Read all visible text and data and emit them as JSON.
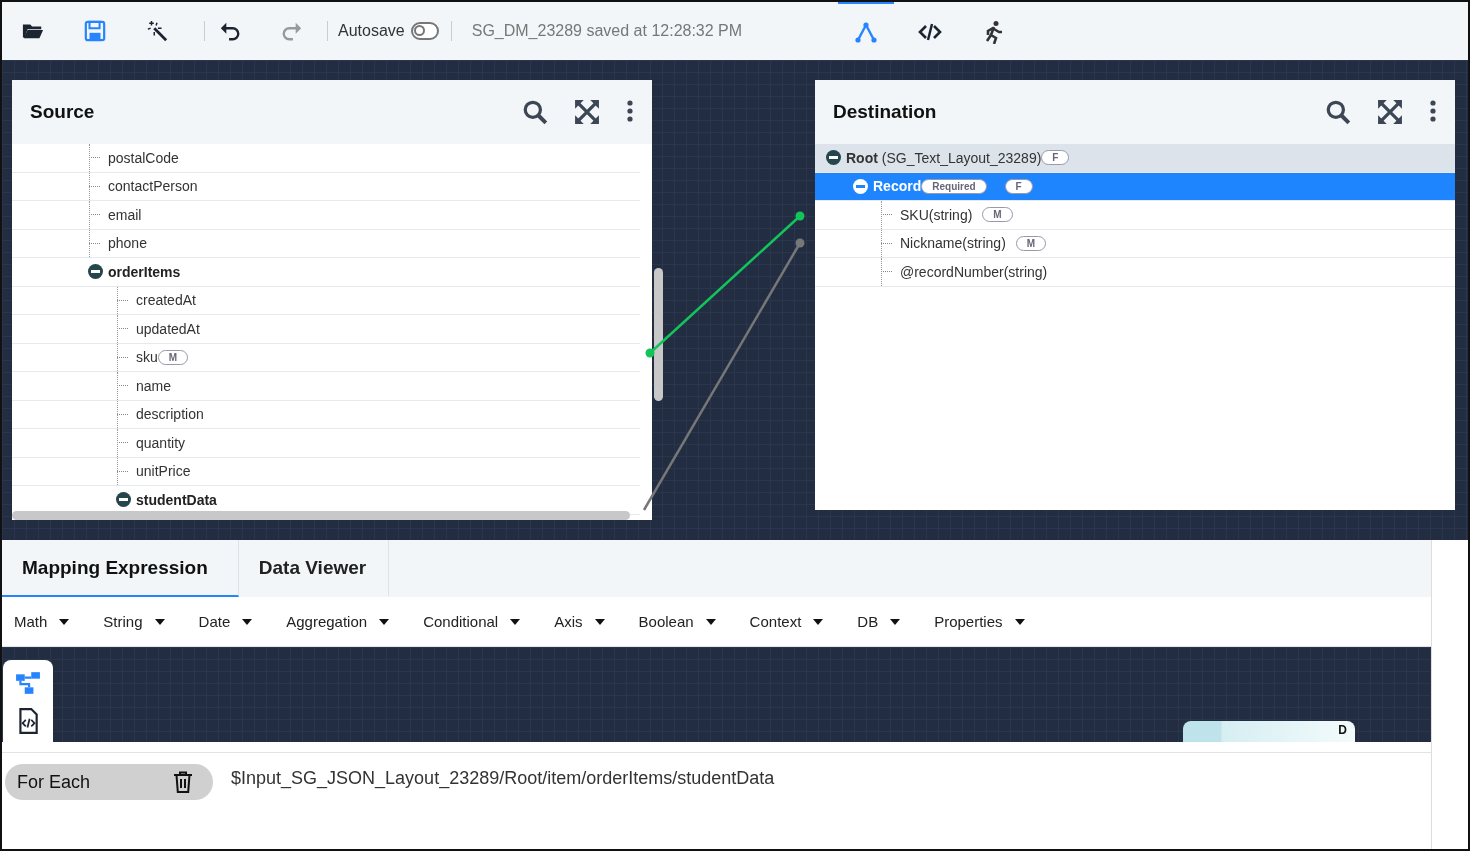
{
  "toolbar": {
    "buttons": [
      {
        "kind": "folder",
        "disabled": false
      },
      {
        "kind": "save",
        "disabled": false
      },
      {
        "kind": "wand",
        "disabled": false
      },
      {
        "kind": "undo",
        "disabled": false
      },
      {
        "kind": "redo",
        "disabled": true
      }
    ],
    "autosave": {
      "label": "Autosave",
      "on": false
    },
    "status": "SG_DM_23289 saved at 12:28:32 PM",
    "views": [
      {
        "kind": "mapping",
        "selected": true
      },
      {
        "kind": "code",
        "selected": false
      },
      {
        "kind": "run",
        "selected": false
      }
    ]
  },
  "source": {
    "title": "Source",
    "items": [
      {
        "label": "postalCode"
      },
      {
        "label": "contactPerson"
      },
      {
        "label": "email"
      },
      {
        "label": "phone"
      },
      {
        "label": "orderItems",
        "expanded": true,
        "children": [
          {
            "label": "createdAt"
          },
          {
            "label": "updatedAt"
          },
          {
            "label": "sku",
            "badges": [
              "M"
            ]
          },
          {
            "label": "name"
          },
          {
            "label": "description"
          },
          {
            "label": "quantity"
          },
          {
            "label": "unitPrice"
          },
          {
            "label": "studentData",
            "expanded": true
          }
        ]
      }
    ]
  },
  "destination": {
    "title": "Destination",
    "items": [
      {
        "label": "**Root** (SG_Text_Layout_23289)",
        "badges": [
          "F"
        ],
        "expanded": true,
        "selected": false,
        "children": [
          {
            "label": "Record",
            "badges": [
              "Required",
              "F"
            ],
            "expanded": true,
            "selected": true,
            "children": [
              {
                "label": "SKU(string)",
                "badges": [
                  "M"
                ],
                "selected": false
              },
              {
                "label": "Nickname(string)",
                "badges": [
                  "M"
                ],
                "selected": false
              },
              {
                "label": "@recordNumber(string)",
                "selected": false
              }
            ]
          }
        ]
      }
    ]
  },
  "links": [
    {
      "active": true
    },
    {
      "active": false
    }
  ],
  "bottom_tabs": [
    {
      "label": "Mapping Expression",
      "selected": true
    },
    {
      "label": "Data Viewer",
      "selected": false
    }
  ],
  "menus": [
    "Math",
    "String",
    "Date",
    "Aggregation",
    "Conditional",
    "Axis",
    "Boolean",
    "Context",
    "DB",
    "Properties"
  ],
  "side_tools": [
    {
      "kind": "tree",
      "selected": true
    },
    {
      "kind": "code",
      "selected": false
    }
  ],
  "node": {
    "label": "D"
  },
  "expression": {
    "chip": "For Each",
    "path": "$Input_SG_JSON_Layout_23289/Root/item/orderItems/studentData"
  }
}
